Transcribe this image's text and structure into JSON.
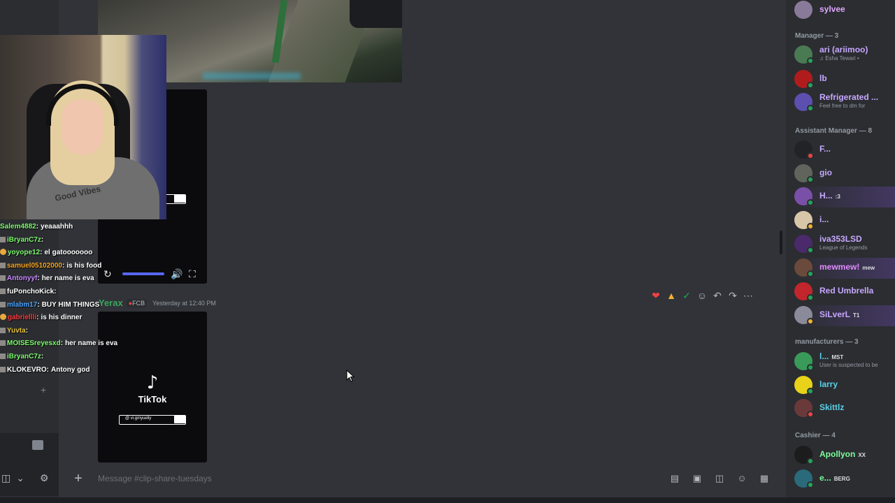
{
  "channel": {
    "composer_placeholder": "Message #clip-share-tuesdays"
  },
  "message": {
    "author": "Yerax",
    "tag": "FCB",
    "timestamp": "Yesterday at 12:40 PM"
  },
  "tiktok": {
    "wordmark": "TikTok",
    "note_glyph": "♪",
    "search_text": "@ vi.gmyuelly"
  },
  "webcam": {
    "shirt_print": "Good Vibes"
  },
  "stream_chat": [
    {
      "user": "Salem4882",
      "text": "yeaaahhh",
      "color": "#7cfc6c"
    },
    {
      "user": "iBryanC7z",
      "text": "",
      "color": "#7cfc6c"
    },
    {
      "user": "yoyope12",
      "text": "el gatooooooo",
      "color": "#7cfc6c"
    },
    {
      "user": "samuel05102000",
      "text": "is his food",
      "color": "#f5a623"
    },
    {
      "user": "Antonyyf",
      "text": "her name is eva",
      "color": "#c98bff"
    },
    {
      "user": "fuPonchoKick",
      "text": "",
      "color": "#ffffff"
    },
    {
      "user": "mlabm17",
      "text": "BUY HIM THINGS",
      "color": "#4aa3ff"
    },
    {
      "user": "gabriellli",
      "text": "is his dinner",
      "color": "#ff3b3b"
    },
    {
      "user": "Yuvta",
      "text": "",
      "color": "#e9c53b"
    },
    {
      "user": "MOISESreyesxd",
      "text": "her name is eva",
      "color": "#7cfc6c"
    },
    {
      "user": "iBryanC7z",
      "text": "",
      "color": "#7cfc6c"
    },
    {
      "user": "KLOKEVRO",
      "text": "Antony god",
      "color": "#ffffff"
    }
  ],
  "members": {
    "top": {
      "name": "sylvee",
      "color": "#e0a6ff"
    },
    "groups": [
      {
        "title": "Manager — 3",
        "members": [
          {
            "name": "ari (ariimoo)",
            "sub": "♫ Esha Tewari •",
            "color": "#c7a8ff",
            "avatar": "#4a7a52",
            "status": "#23a55a"
          },
          {
            "name": "lb",
            "sub": "",
            "color": "#c7a8ff",
            "avatar": "#b01c1c",
            "status": "#23a55a"
          },
          {
            "name": "Refrigerated ...",
            "sub": "Feel free to dm for",
            "color": "#c7a8ff",
            "avatar": "#5b4fb0",
            "status": "#23a55a"
          }
        ]
      },
      {
        "title": "Assistant Manager — 8",
        "members": [
          {
            "name": "F...",
            "sub": "",
            "color": "#c7a8ff",
            "avatar": "#222326",
            "status": "#ed4245"
          },
          {
            "name": "gio",
            "sub": "",
            "color": "#c7a8ff",
            "avatar": "#60655c",
            "status": "#23a55a"
          },
          {
            "name": "H...",
            "sub": "",
            "tag": ":3",
            "color": "#c7a8ff",
            "avatar": "#7a4fa8",
            "status": "#23a55a"
          },
          {
            "name": "i...",
            "sub": "",
            "color": "#c7a8ff",
            "avatar": "#d8c6a8",
            "status": "#f0b232"
          },
          {
            "name": "iva353LSD",
            "sub": "League of Legends",
            "color": "#c7a8ff",
            "avatar": "#4a2a6a",
            "status": "#23a55a"
          },
          {
            "name": "mewmew!",
            "sub": "",
            "tag": "mew",
            "color": "#e08bff",
            "avatar": "#6a4a3a",
            "status": "#23a55a"
          },
          {
            "name": "Red Umbrella",
            "sub": "",
            "color": "#c7a8ff",
            "avatar": "#c0262b",
            "status": "#23a55a"
          },
          {
            "name": "SiLverL",
            "sub": "",
            "tag": "T1",
            "color": "#c7a8ff",
            "avatar": "#8a8a9a",
            "status": "#f0b232"
          }
        ]
      },
      {
        "title": "manufacturers — 3",
        "members": [
          {
            "name": "l...",
            "sub": "User is suspected to be",
            "tag": "MST",
            "color": "#5ad1e8",
            "avatar": "#3a9a5a",
            "status": "#23a55a"
          },
          {
            "name": "larry",
            "sub": "",
            "color": "#5ad1e8",
            "avatar": "#e8d21a",
            "status": "#23a55a"
          },
          {
            "name": "Skittlz",
            "sub": "",
            "color": "#5ad1e8",
            "avatar": "#6a3a3a",
            "status": "#ed4245"
          }
        ]
      },
      {
        "title": "Cashier — 4",
        "members": [
          {
            "name": "Apollyon",
            "sub": "",
            "tag": "XX",
            "color": "#7cfc9c",
            "avatar": "#1c1c1c",
            "status": "#23a55a"
          },
          {
            "name": "e...",
            "sub": "",
            "tag": "BERG",
            "color": "#7cfc9c",
            "avatar": "#2a6a7a",
            "status": "#23a55a"
          }
        ]
      }
    ]
  },
  "colors": {
    "chat_bg": "#313338",
    "sidebar_bg": "#2b2d31",
    "accent": "#5865f2"
  }
}
